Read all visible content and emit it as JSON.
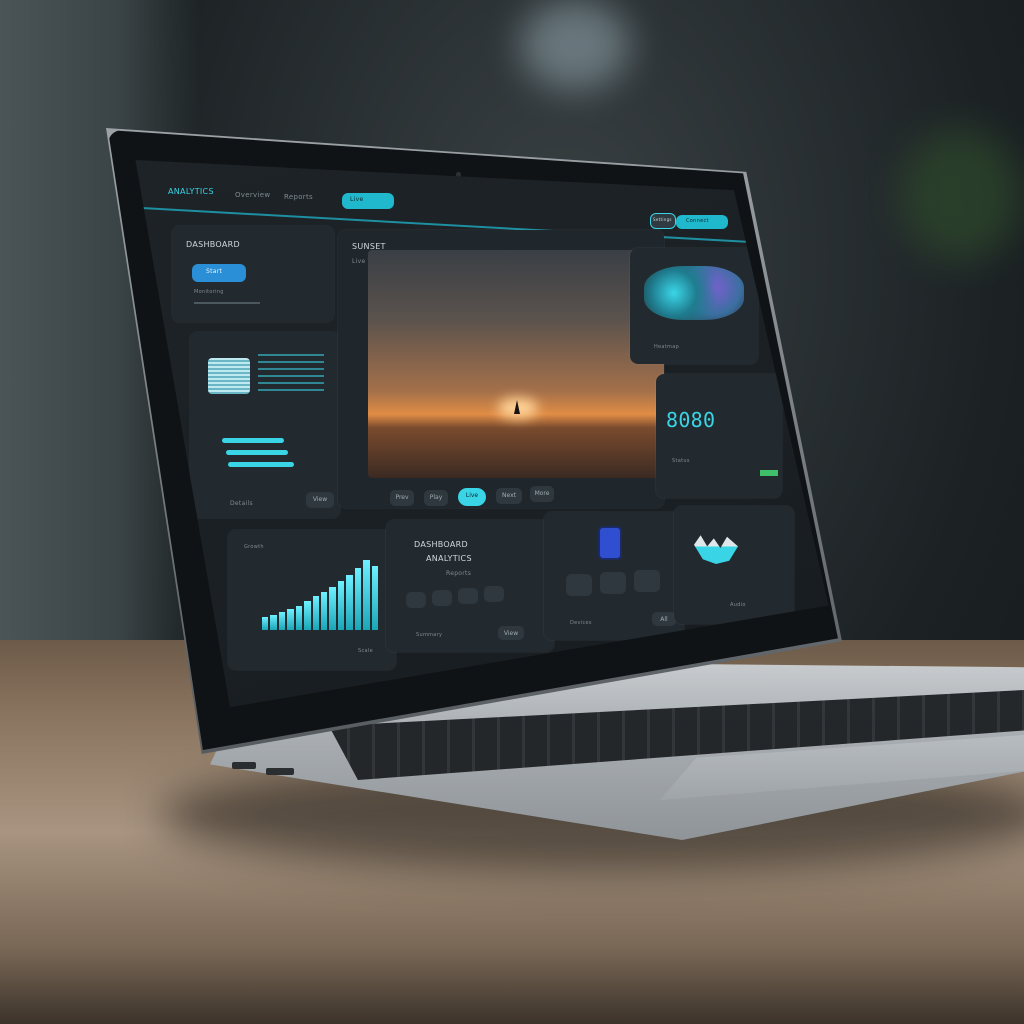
{
  "header": {
    "brand": "ANALYTICS",
    "nav": [
      "Overview",
      "Reports"
    ],
    "active_tab": "Live",
    "top_right_label": "Settings",
    "top_right_action": "Connect"
  },
  "left_panel": {
    "title": "DASHBOARD",
    "button": "Start",
    "caption": "Monitoring",
    "footer_label": "Details",
    "footer_action": "View"
  },
  "media_panel": {
    "title": "SUNSET",
    "subtitle": "Live View",
    "controls": [
      "Prev",
      "Play",
      "Live",
      "Next",
      "More"
    ]
  },
  "right_top": {
    "caption": "Heatmap"
  },
  "right_metric": {
    "value": "8080",
    "label": "Status"
  },
  "bottom_chart": {
    "title": "Growth",
    "footer": "Scale"
  },
  "bottom_text": {
    "line1": "DASHBOARD",
    "line2": "ANALYTICS",
    "line3": "Reports",
    "footer": "Summary",
    "footer_action": "View"
  },
  "bottom_device": {
    "footer": "Devices",
    "footer_action": "All"
  },
  "bottom_wave": {
    "caption": "Audio"
  },
  "colors": {
    "accent": "#39d4e6",
    "panel": "#232a2f",
    "screen": "#1a2024"
  },
  "chart_bars": [
    0.18,
    0.22,
    0.26,
    0.3,
    0.35,
    0.42,
    0.48,
    0.55,
    0.62,
    0.7,
    0.78,
    0.88,
    1.0,
    0.92
  ]
}
